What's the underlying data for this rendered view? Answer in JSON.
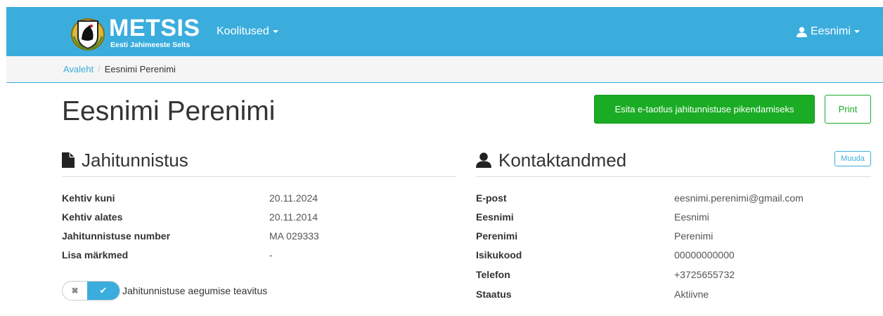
{
  "navbar": {
    "brand_title": "METSIS",
    "brand_subtitle": "Eesti Jahimeeste Selts",
    "menu_label": "Koolitused",
    "user_label": "Eesnimi"
  },
  "breadcrumb": {
    "home": "Avaleht",
    "separator": "/",
    "current": "Eesnimi Perenimi"
  },
  "page": {
    "title": "Eesnimi Perenimi",
    "primary_button": "Esita e-taotlus jahitunnistuse pikendamiseks",
    "print_button": "Print"
  },
  "license": {
    "heading": "Jahitunnistus",
    "rows": [
      {
        "label": "Kehtiv kuni",
        "value": "20.11.2024"
      },
      {
        "label": "Kehtiv alates",
        "value": "20.11.2014"
      },
      {
        "label": "Jahitunnistuse number",
        "value": "MA 029333"
      },
      {
        "label": "Lisa märkmed",
        "value": "-"
      }
    ],
    "toggle_on": true,
    "toggle_label": "Jahitunnistuse aegumise teavitus"
  },
  "contact": {
    "heading": "Kontaktandmed",
    "edit_button": "Muuda",
    "rows": [
      {
        "label": "E-post",
        "value": "eesnimi.perenimi@gmail.com"
      },
      {
        "label": "Eesnimi",
        "value": "Eesnimi"
      },
      {
        "label": "Perenimi",
        "value": "Perenimi"
      },
      {
        "label": "Isikukood",
        "value": "00000000000"
      },
      {
        "label": "Telefon",
        "value": "+3725655732"
      },
      {
        "label": "Staatus",
        "value": "Aktiivne"
      }
    ]
  },
  "colors": {
    "navbar": "#3aaddd",
    "primary_green": "#1aac24",
    "link_blue": "#3aaddd"
  }
}
